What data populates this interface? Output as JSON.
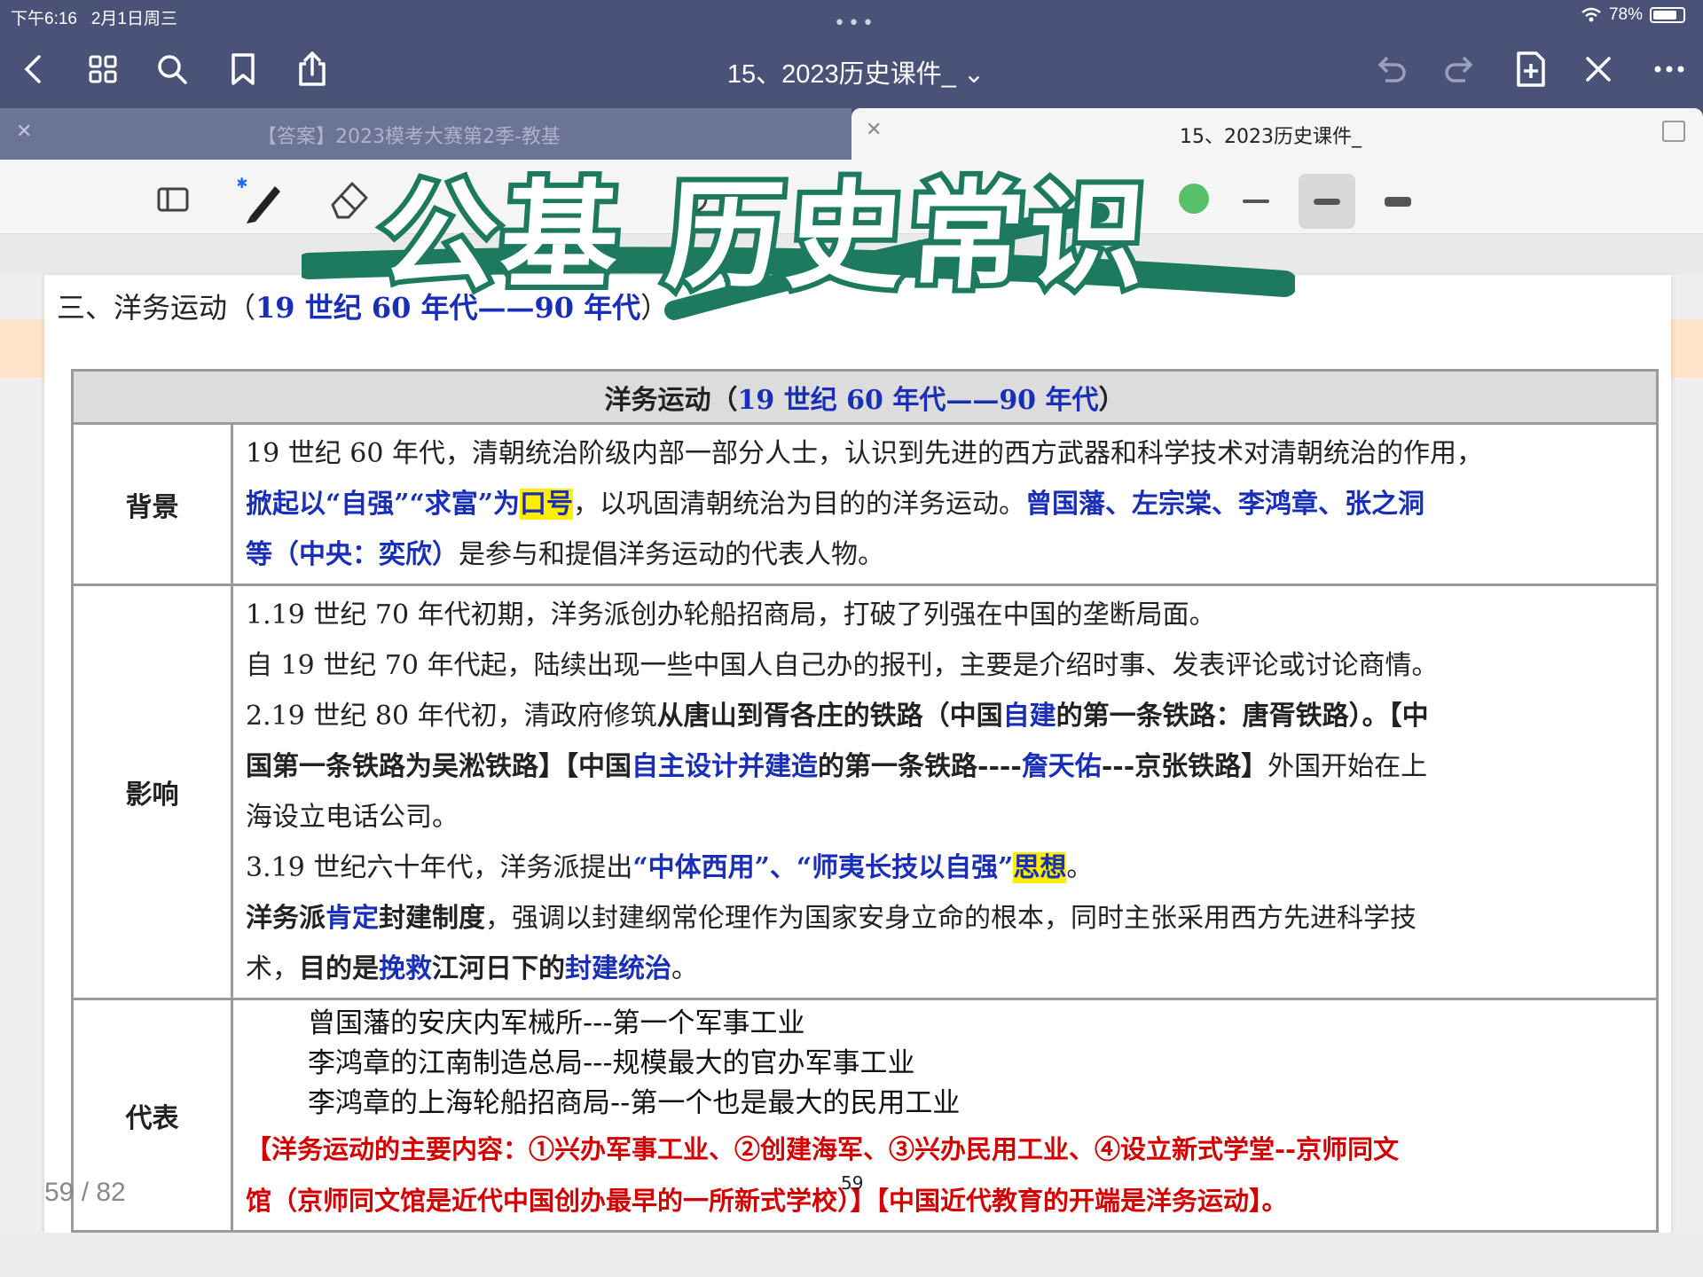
{
  "status": {
    "time": "下午6:16",
    "date": "2月1日周三",
    "battery": "78%"
  },
  "toolbar": {
    "doc_title": "15、2023历史课件_ ⌄"
  },
  "tabs": [
    {
      "label": "【答案】2023模考大赛第2季-教基"
    },
    {
      "label": "15、2023历史课件_"
    }
  ],
  "overlay": {
    "title": "公基 历史常识"
  },
  "section_heading": {
    "prefix": "三、洋务运动（",
    "range": "19 世纪 60 年代——90 年代",
    "suffix": "）"
  },
  "table": {
    "header_prefix": "洋务运动（",
    "header_range": "19 世纪 60 年代——90 年代",
    "header_suffix": "）",
    "rows": [
      {
        "category": "背景",
        "lines": [
          [
            {
              "t": "19 世纪 60 年代，清朝统治阶级内部一部分人士，认识到先进的西方武器和科学技术对清朝统治的作用，",
              "c": ""
            }
          ],
          [
            {
              "t": "掀起以“自强”“求富”为",
              "c": "blue b"
            },
            {
              "t": "口号",
              "c": "blue b hl"
            },
            {
              "t": "，以巩固清朝统治为目的的洋务运动。",
              "c": ""
            },
            {
              "t": "曾国藩、左宗棠、李鸿章、张之洞",
              "c": "blue b"
            }
          ],
          [
            {
              "t": "等（中央：奕欣）",
              "c": "blue b"
            },
            {
              "t": "是参与和提倡洋务运动的代表人物。",
              "c": ""
            }
          ]
        ]
      },
      {
        "category": "影响",
        "lines": [
          [
            {
              "t": "1.19 世纪 70 年代初期，洋务派创办轮船招商局，打破了列强在中国的垄断局面。",
              "c": ""
            }
          ],
          [
            {
              "t": "自 19 世纪 70 年代起，陆续出现一些中国人自己办的报刊，主要是介绍时事、发表评论或讨论商情。",
              "c": ""
            }
          ],
          [
            {
              "t": "2.19 世纪 80 年代初，清政府修筑",
              "c": ""
            },
            {
              "t": "从唐山到胥各庄的铁路（中国",
              "c": "b"
            },
            {
              "t": "自建",
              "c": "blue b"
            },
            {
              "t": "的第一条铁路：唐胥铁路）。【中",
              "c": "b"
            }
          ],
          [
            {
              "t": "国第一条铁路为吴淞铁路】【中国",
              "c": "b"
            },
            {
              "t": "自主设计并建造",
              "c": "blue b"
            },
            {
              "t": "的第一条铁路----",
              "c": "b"
            },
            {
              "t": "詹天佑",
              "c": "blue b"
            },
            {
              "t": "---京张铁路】",
              "c": "b"
            },
            {
              "t": "外国开始在上",
              "c": ""
            }
          ],
          [
            {
              "t": "海设立电话公司。",
              "c": ""
            }
          ],
          [
            {
              "t": "3.19 世纪六十年代，洋务派提出",
              "c": ""
            },
            {
              "t": "“中体西用”、“师夷长技以自强”",
              "c": "blue b"
            },
            {
              "t": "思想",
              "c": "blue b hl"
            },
            {
              "t": "。",
              "c": ""
            }
          ],
          [
            {
              "t": "洋务派",
              "c": "b"
            },
            {
              "t": "肯定",
              "c": "blue b"
            },
            {
              "t": "封建制度",
              "c": "b"
            },
            {
              "t": "，强调以封建纲常伦理作为国家安身立命的根本，同时主张采用西方先进科学技",
              "c": ""
            }
          ],
          [
            {
              "t": "术，",
              "c": ""
            },
            {
              "t": "目的是",
              "c": "b"
            },
            {
              "t": "挽救",
              "c": "blue b"
            },
            {
              "t": "江河日下的",
              "c": "b"
            },
            {
              "t": "封建统治",
              "c": "blue b"
            },
            {
              "t": "。",
              "c": ""
            }
          ]
        ]
      },
      {
        "category": "代表",
        "items": [
          "曾国藩的安庆内军械所---第一个军事工业",
          "李鸿章的江南制造总局---规模最大的官办军事工业",
          "李鸿章的上海轮船招商局--第一个也是最大的民用工业"
        ],
        "red_lines": [
          "【洋务运动的主要内容：①兴办军事工业、②创建海军、③兴办民用工业、④设立新式学堂--京师同文",
          "馆（京师同文馆是近代中国创办最早的一所新式学校）】【中国近代教育的开端是洋务运动】。"
        ]
      }
    ]
  },
  "footer": {
    "page_counter": "59 / 82",
    "page_mark": "59"
  },
  "colors": {
    "header_bg": "#4a5278",
    "overlay_stroke": "#1e7a5e",
    "highlight": "#ffee00",
    "blue_text": "#1a2fb8",
    "red_text": "#d40000"
  }
}
